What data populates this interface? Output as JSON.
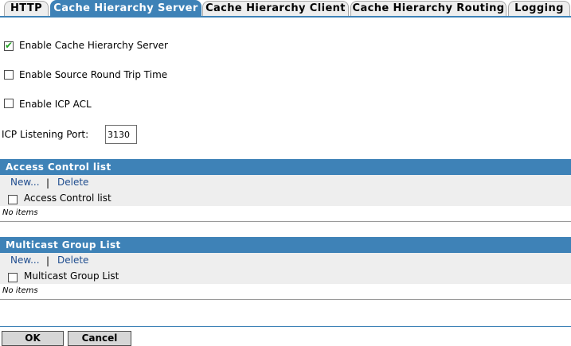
{
  "tabs": [
    {
      "label": "HTTP",
      "active": false
    },
    {
      "label": "Cache Hierarchy Server",
      "active": true
    },
    {
      "label": "Cache Hierarchy Client",
      "active": false
    },
    {
      "label": "Cache Hierarchy Routing",
      "active": false
    },
    {
      "label": "Logging",
      "active": false
    }
  ],
  "options": {
    "enable_server": {
      "label": "Enable Cache Hierarchy Server",
      "checked": true
    },
    "enable_rtt": {
      "label": "Enable Source Round Trip Time",
      "checked": false
    },
    "enable_icp_acl": {
      "label": "Enable ICP ACL",
      "checked": false
    }
  },
  "icp_port": {
    "label": "ICP Listening Port:",
    "value": "3130"
  },
  "acl_section": {
    "title": "Access Control list",
    "new_label": "New...",
    "separator": "|",
    "delete_label": "Delete",
    "column_label": "Access Control list",
    "empty_text": "No items"
  },
  "multicast_section": {
    "title": "Multicast Group List",
    "new_label": "New...",
    "separator": "|",
    "delete_label": "Delete",
    "column_label": "Multicast Group List",
    "empty_text": "No items"
  },
  "footer": {
    "ok_label": "OK",
    "cancel_label": "Cancel"
  },
  "colors": {
    "accent": "#3e82b7",
    "link": "#1e4c8e",
    "check": "#21a121",
    "section_bg": "#eeeeee"
  }
}
